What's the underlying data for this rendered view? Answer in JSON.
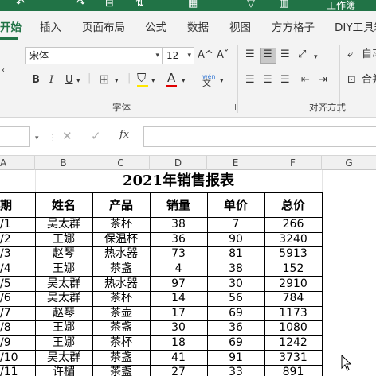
{
  "titlebar": {
    "icons": [
      "undo-icon",
      "redo-icon",
      "save-icon",
      "sort-icon",
      "table-icon",
      "filter-icon",
      "chart-icon"
    ],
    "text": "工作簿"
  },
  "tabs": [
    "开始",
    "插入",
    "页面布局",
    "公式",
    "数据",
    "视图",
    "方方格子",
    "DIY工具箱"
  ],
  "ribbon": {
    "font_name": "宋体",
    "font_size": "12",
    "grow_font": "A^",
    "shrink_font": "Aˇ",
    "bold": "B",
    "italic": "I",
    "underline": "U",
    "font_color_letter": "A",
    "phonetic": "wén",
    "font_group_label": "字体",
    "align_group_label": "对齐方式",
    "wrap_text": "自动",
    "merge_center": "合并",
    "highlight_color": "#ffe600",
    "font_color": "#e00000",
    "brand_color": "#217346"
  },
  "formula_bar": {
    "cancel": "✕",
    "enter": "✓",
    "fx": "fx",
    "value": ""
  },
  "columns": [
    "A",
    "B",
    "C",
    "D",
    "E",
    "F",
    "G"
  ],
  "sheet": {
    "title": "2021年销售报表",
    "headers": [
      "期",
      "姓名",
      "产品",
      "销量",
      "单价",
      "总价"
    ],
    "rows": [
      [
        "/1",
        "吴太群",
        "茶杯",
        "38",
        "7",
        "266"
      ],
      [
        "/2",
        "王娜",
        "保温杯",
        "36",
        "90",
        "3240"
      ],
      [
        "/3",
        "赵琴",
        "热水器",
        "73",
        "81",
        "5913"
      ],
      [
        "/4",
        "王娜",
        "茶盏",
        "4",
        "38",
        "152"
      ],
      [
        "/5",
        "吴太群",
        "热水器",
        "97",
        "30",
        "2910"
      ],
      [
        "/6",
        "吴太群",
        "茶杯",
        "14",
        "56",
        "784"
      ],
      [
        "/7",
        "赵琴",
        "茶壶",
        "17",
        "69",
        "1173"
      ],
      [
        "/8",
        "王娜",
        "茶盏",
        "30",
        "36",
        "1080"
      ],
      [
        "/9",
        "王娜",
        "茶杯",
        "18",
        "69",
        "1242"
      ],
      [
        "/10",
        "吴太群",
        "茶盏",
        "41",
        "91",
        "3731"
      ],
      [
        "/11",
        "许楣",
        "茶盏",
        "27",
        "33",
        "891"
      ]
    ]
  }
}
